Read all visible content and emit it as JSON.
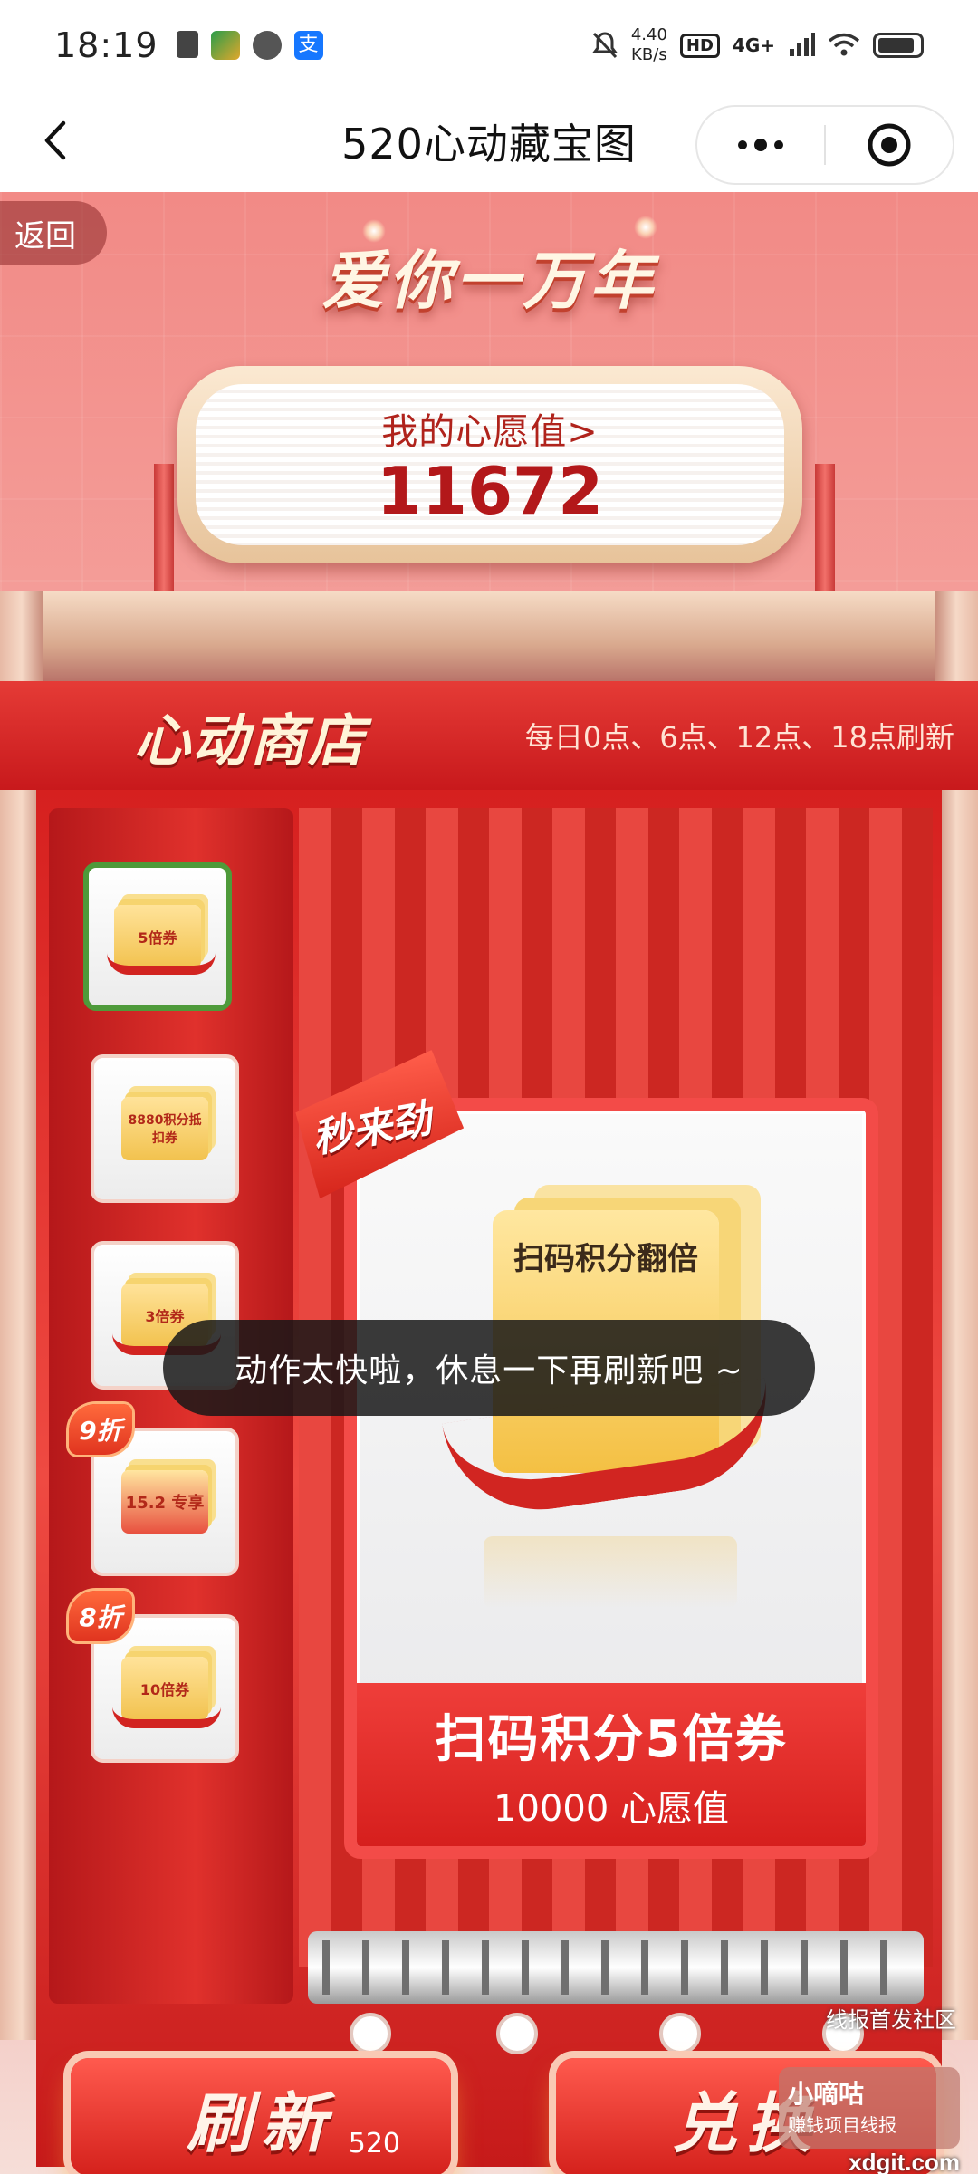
{
  "status_bar": {
    "time": "18:19",
    "net_speed_value": "4.40",
    "net_speed_unit": "KB/s",
    "hd": "HD",
    "network": "4G+"
  },
  "title_bar": {
    "title": "520心动藏宝图"
  },
  "game": {
    "back_label": "返回",
    "banner_title": "爱你一万年",
    "wish_label": "我的心愿值>",
    "wish_value": "11672",
    "store_title": "心动商店",
    "refresh_note": "每日0点、6点、12点、18点刷新",
    "thumbnails": [
      {
        "label": "5倍券",
        "selected": true
      },
      {
        "label": "8880积分抵扣券"
      },
      {
        "label": "3倍券"
      },
      {
        "label": "15.2 专享",
        "discount": "9折"
      },
      {
        "label": "10倍券",
        "discount": "8折"
      }
    ],
    "flash_badge": "秒来劲",
    "product": {
      "art_text": "扫码积分翻倍",
      "name": "扫码积分5倍券",
      "cost": "10000 心愿值"
    },
    "toast": "动作太快啦，休息一下再刷新吧 ~",
    "refresh_button": {
      "label": "刷新",
      "cost": "520"
    },
    "exchange_button": {
      "label": "兑换"
    }
  },
  "watermark": {
    "line1": "线报首发社区",
    "brand": "小嘀咕",
    "line2": "赚钱项目线报",
    "site": "xdgit.com"
  },
  "colors": {
    "accent_red": "#d6261c",
    "selected_border": "#4e9a3a",
    "wish_value": "#b3181a"
  }
}
